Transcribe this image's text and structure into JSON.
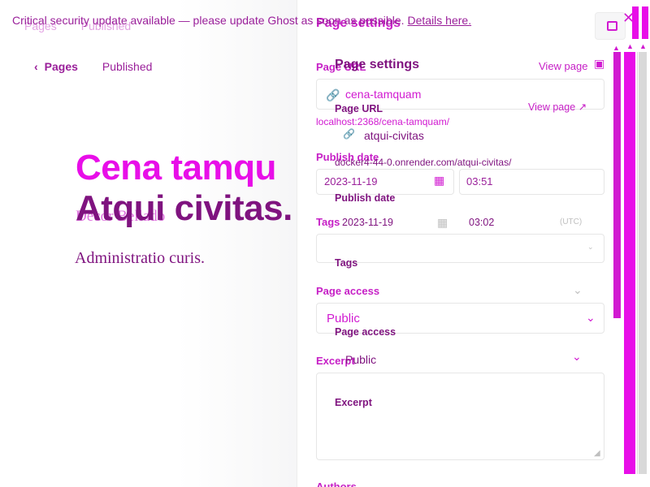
{
  "banner": {
    "text": "Critical security update available — please update Ghost as soon as possible.",
    "link": "Details here."
  },
  "breadcrumb": {
    "pages": "Pages",
    "status": "Published"
  },
  "post": {
    "title_ghost": "Cena tamqu",
    "title": "Atqui civitas.",
    "subtitle_ghost": "Decor Bellado",
    "excerpt": "Administratio curis."
  },
  "settings_back": {
    "header": "Page settings",
    "page_url_label": "Page URL",
    "slug": "cena-tamquam",
    "url": "localhost:2368/cena-tamquam/",
    "publish_date_label": "Publish date",
    "date": "2023-11-19",
    "time": "03:51",
    "timezone": "(UTC)",
    "tags_label": "Tags",
    "page_access_label": "Page access",
    "access_value": "Public",
    "excerpt_label": "Excerpt",
    "authors_label": "Authors"
  },
  "settings": {
    "header": "Page settings",
    "view_page": "View page",
    "page_url_label": "Page URL",
    "slug": "atqui-civitas",
    "url": "docker4-44-0.onrender.com/atqui-civitas/",
    "publish_date_label": "Publish date",
    "date": "2023-11-19",
    "time": "03:02",
    "timezone": "(UTC)",
    "tags_label": "Tags",
    "page_access_label": "Page access",
    "access_value": "Public",
    "excerpt_label": "Excerpt"
  },
  "colors": {
    "accent": "#e80ee8",
    "accent_dark": "#7f137f"
  }
}
